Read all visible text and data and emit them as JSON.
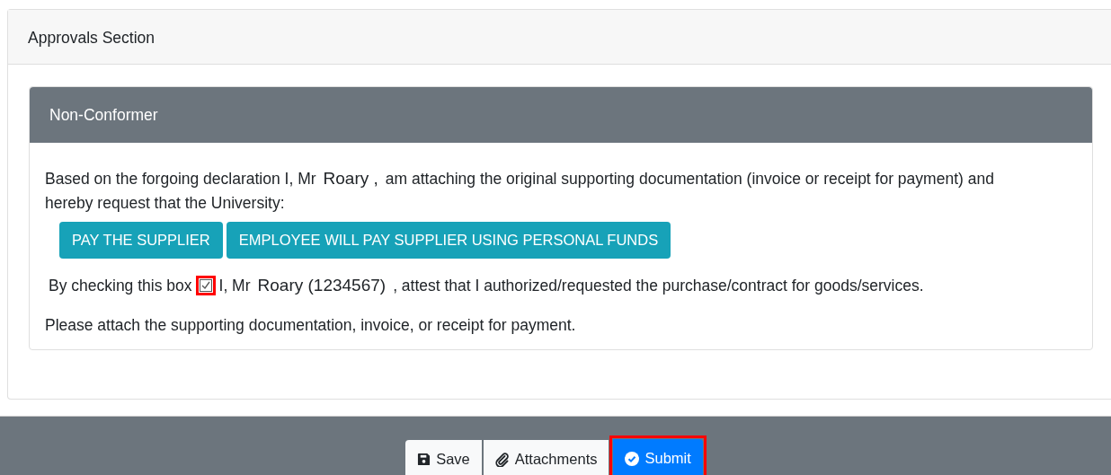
{
  "section": {
    "title": "Approvals Section"
  },
  "panel": {
    "title": "Non-Conformer",
    "declaration": {
      "intro": "Based on the forgoing declaration I, Mr",
      "name": "Roary ,",
      "rest": "am attaching the original supporting documentation (invoice or receipt for payment) and hereby request that the University:"
    },
    "options": [
      {
        "label": "PAY THE SUPPLIER"
      },
      {
        "label": "EMPLOYEE WILL PAY SUPPLIER USING PERSONAL FUNDS"
      }
    ],
    "attest": {
      "before": "By checking this box",
      "checked": true,
      "highlighted": true,
      "prefix": "I, Mr",
      "name": "Roary (1234567)",
      "rest": ", attest that I authorized/requested the purchase/contract for goods/services."
    },
    "note": "Please attach the supporting documentation, invoice, or receipt for payment."
  },
  "footer": {
    "buttons": [
      {
        "kind": "save",
        "label": "Save",
        "highlighted": false
      },
      {
        "kind": "attach",
        "label": "Attachments",
        "highlighted": false
      },
      {
        "kind": "submit",
        "label": "Submit",
        "highlighted": true
      }
    ]
  }
}
